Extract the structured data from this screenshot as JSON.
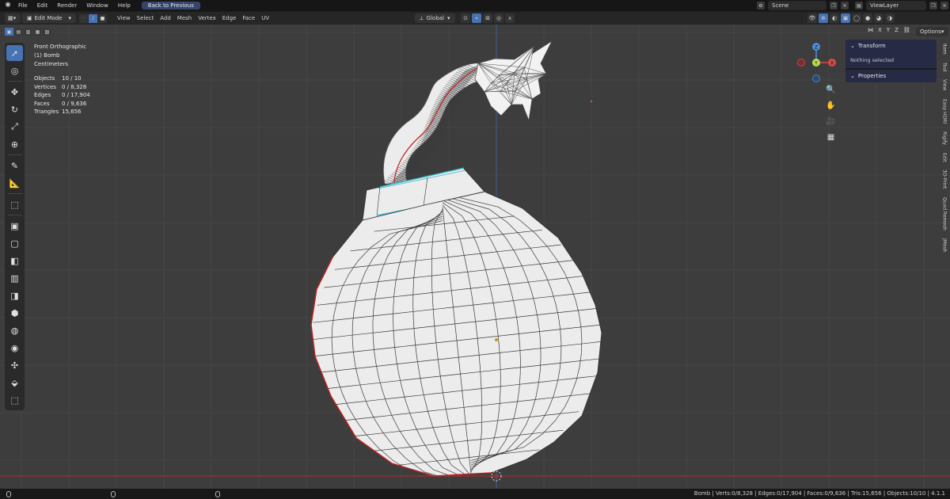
{
  "menubar": {
    "items": [
      "File",
      "Edit",
      "Render",
      "Window",
      "Help"
    ],
    "back_button": "Back to Previous",
    "scene": "Scene",
    "view_layer": "ViewLayer"
  },
  "header": {
    "mode": "Edit Mode",
    "menus": [
      "View",
      "Select",
      "Add",
      "Mesh",
      "Vertex",
      "Edge",
      "Face",
      "UV"
    ],
    "transform_orientation": "Global"
  },
  "mirror": {
    "axes": [
      "X",
      "Y",
      "Z"
    ],
    "options_label": "Options"
  },
  "viewport": {
    "view_name": "Front Orthographic",
    "object_name": "(1) Bomb",
    "units": "Centimeters",
    "stats": [
      {
        "label": "Objects",
        "value": "10 / 10"
      },
      {
        "label": "Vertices",
        "value": "0 / 8,328"
      },
      {
        "label": "Edges",
        "value": "0 / 17,904"
      },
      {
        "label": "Faces",
        "value": "0 / 9,636"
      },
      {
        "label": "Triangles",
        "value": "15,656"
      }
    ]
  },
  "gizmo": {
    "z": "Z",
    "y": "Y",
    "x": "X"
  },
  "npanel": {
    "transform_title": "Transform",
    "transform_body": "Nothing selected",
    "properties_title": "Properties",
    "tabs": [
      "Item",
      "Tool",
      "View",
      "Easy HDRI",
      "Rigify",
      "Edit",
      "3D-Print",
      "Quad Remesh",
      "JMesh"
    ]
  },
  "status": {
    "text": "Bomb | Verts:0/8,328 | Edges:0/17,904 | Faces:0/9,636 | Tris:15,656 | Objects:10/10 | 4.1.1"
  },
  "colors": {
    "accent": "#4772b3",
    "seam": "#d02020",
    "sharp": "#2ab6c8",
    "axis_x": "#d84a4a",
    "axis_y": "#8bc34a",
    "axis_z": "#4a8fd8"
  }
}
